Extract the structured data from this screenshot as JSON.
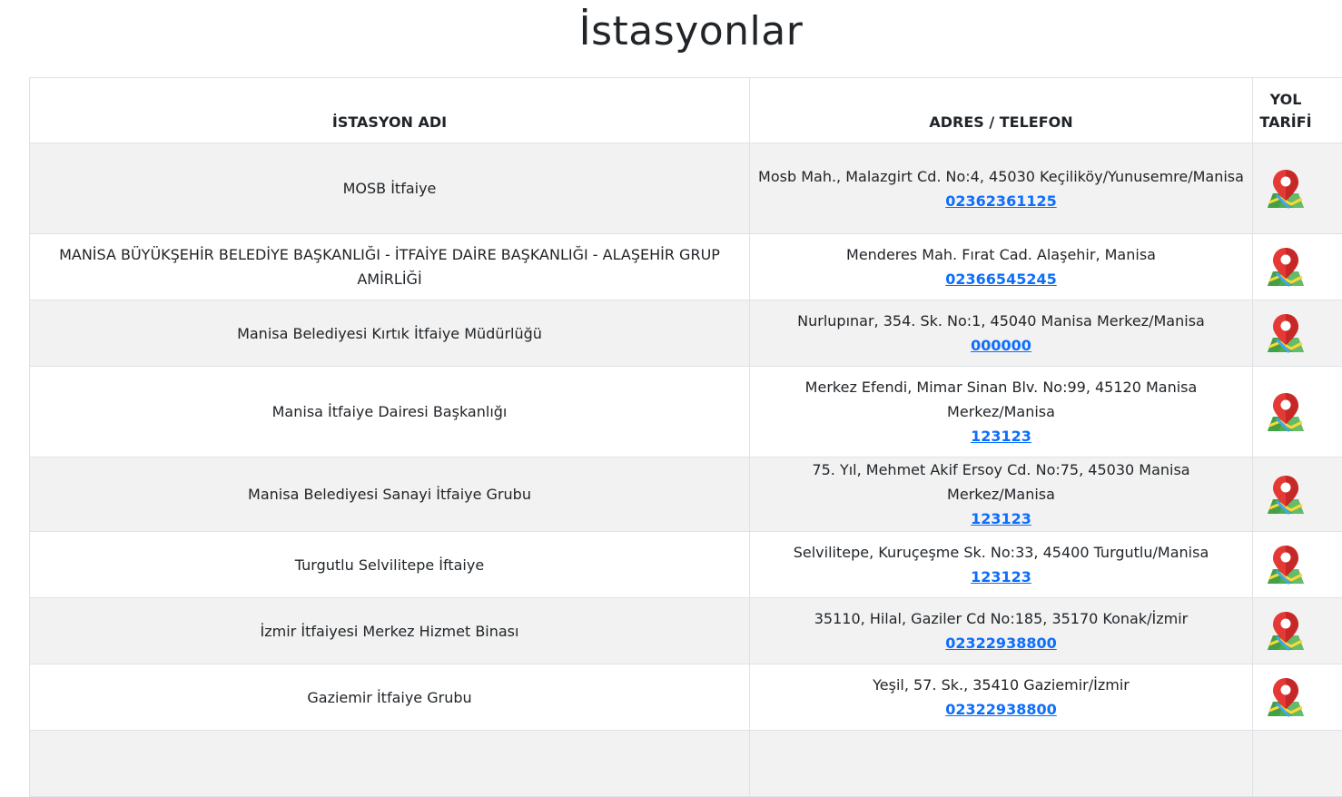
{
  "page": {
    "title": "İstasyonlar"
  },
  "table": {
    "headers": {
      "name": "İSTASYON ADI",
      "address": "ADRES / TELEFON",
      "route_line1": "YOL",
      "route_line2": "TARİFİ"
    },
    "rows": [
      {
        "name": "MOSB İtfaiye",
        "address": "Mosb Mah., Malazgirt Cd. No:4, 45030 Keçiliköy/Yunusemre/Manisa",
        "phone": "02362361125",
        "icon": "map-pin-icon"
      },
      {
        "name": "MANİSA BÜYÜKŞEHİR BELEDİYE BAŞKANLIĞI - İTFAİYE DAİRE BAŞKANLIĞI - ALAŞEHİR GRUP AMİRLİĞİ",
        "address": "Menderes Mah. Fırat Cad. Alaşehir, Manisa",
        "phone": "02366545245",
        "icon": "map-pin-icon"
      },
      {
        "name": "Manisa Belediyesi Kırtık İtfaiye Müdürlüğü",
        "address": "Nurlupınar, 354. Sk. No:1, 45040 Manisa Merkez/Manisa",
        "phone": "000000",
        "icon": "map-pin-icon"
      },
      {
        "name": "Manisa İtfaiye Dairesi Başkanlığı",
        "address": "Merkez Efendi, Mimar Sinan Blv. No:99, 45120 Manisa Merkez/Manisa",
        "phone": "123123",
        "icon": "map-pin-icon"
      },
      {
        "name": "Manisa Belediyesi Sanayi İtfaiye Grubu",
        "address": "75. Yıl, Mehmet Akif Ersoy Cd. No:75, 45030 Manisa Merkez/Manisa",
        "phone": "123123",
        "icon": "map-pin-icon"
      },
      {
        "name": "Turgutlu Selvilitepe İftaiye",
        "address": "Selvilitepe, Kuruçeşme Sk. No:33, 45400 Turgutlu/Manisa",
        "phone": "123123",
        "icon": "map-pin-icon"
      },
      {
        "name": "İzmir İtfaiyesi Merkez Hizmet Binası",
        "address": "35110, Hilal, Gaziler Cd No:185, 35170 Konak/İzmir",
        "phone": "02322938800",
        "icon": "map-pin-icon"
      },
      {
        "name": "Gaziemir İtfaiye Grubu",
        "address": "Yeşil, 57. Sk., 35410 Gaziemir/İzmir",
        "phone": "02322938800",
        "icon": "map-pin-icon"
      },
      {
        "name": "",
        "address": "",
        "phone": "",
        "icon": ""
      }
    ]
  }
}
